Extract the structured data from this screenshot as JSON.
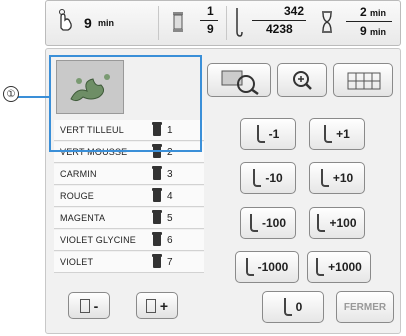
{
  "callout": {
    "number": "①"
  },
  "status": {
    "time_per_color": "9",
    "time_unit": "min",
    "color_current": "1",
    "color_total": "9",
    "stitch_current": "342",
    "stitch_total": "4238",
    "total_time": "2",
    "total_time_remaining": "9",
    "total_unit": "min"
  },
  "colors": [
    {
      "name": "VERT TILLEUL",
      "number": "1",
      "selected": true
    },
    {
      "name": "VERT MOUSSE",
      "number": "2"
    },
    {
      "name": "CARMIN",
      "number": "3"
    },
    {
      "name": "ROUGE",
      "number": "4"
    },
    {
      "name": "MAGENTA",
      "number": "5"
    },
    {
      "name": "VIOLET GLYCINE",
      "number": "6"
    },
    {
      "name": "VIOLET",
      "number": "7"
    }
  ],
  "stitch_buttons": [
    {
      "label": "-1"
    },
    {
      "label": "+1"
    },
    {
      "label": "-10"
    },
    {
      "label": "+10"
    },
    {
      "label": "-100"
    },
    {
      "label": "+100"
    },
    {
      "label": "-1000"
    },
    {
      "label": "+1000"
    }
  ],
  "reset_button": {
    "label": "0"
  },
  "close_button": {
    "label": "FERMER"
  },
  "spool_buttons": {
    "minus": "-",
    "plus": "+"
  }
}
